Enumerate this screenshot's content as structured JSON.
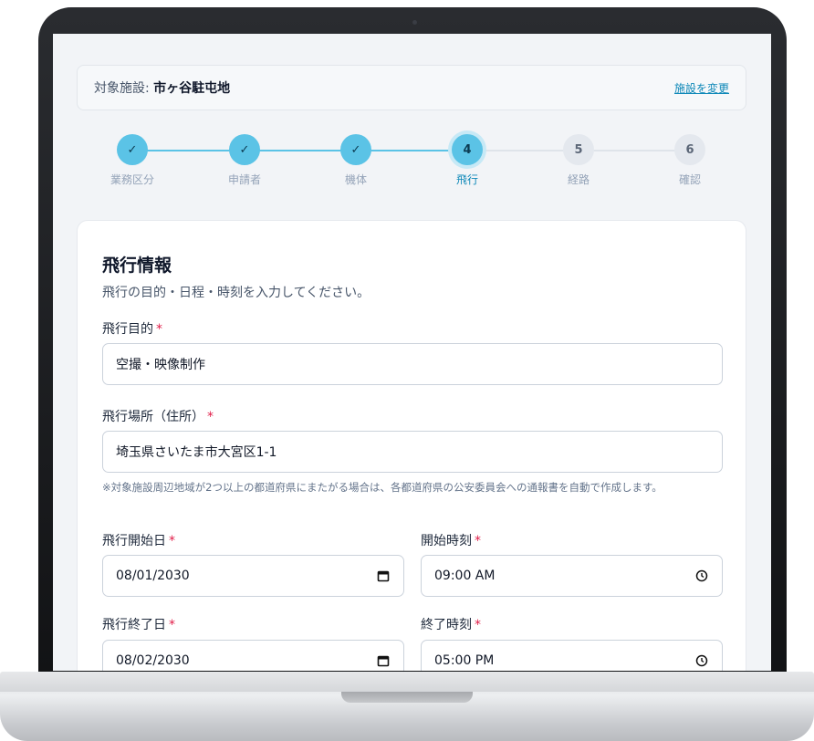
{
  "facility": {
    "label": "対象施設: ",
    "name": "市ヶ谷駐屯地",
    "change_link": "施設を変更"
  },
  "stepper": {
    "steps": [
      {
        "label": "業務区分",
        "mark": "✓",
        "status": "done"
      },
      {
        "label": "申請者",
        "mark": "✓",
        "status": "done"
      },
      {
        "label": "機体",
        "mark": "✓",
        "status": "done"
      },
      {
        "label": "飛行",
        "mark": "4",
        "status": "active"
      },
      {
        "label": "経路",
        "mark": "5",
        "status": "todo"
      },
      {
        "label": "確認",
        "mark": "6",
        "status": "todo"
      }
    ]
  },
  "form": {
    "title": "飛行情報",
    "description": "飛行の目的・日程・時刻を入力してください。",
    "required_mark": "*",
    "purpose": {
      "label": "飛行目的",
      "value": "空撮・映像制作"
    },
    "location": {
      "label": "飛行場所（住所）",
      "value": "埼玉県さいたま市大宮区1-1"
    },
    "note": "※対象施設周辺地域が2つ以上の都道府県にまたがる場合は、各都道府県の公安委員会への通報書を自動で作成します。",
    "start_date": {
      "label": "飛行開始日",
      "value": "08/01/2030"
    },
    "start_time": {
      "label": "開始時刻",
      "value": "09:00 AM"
    },
    "end_date": {
      "label": "飛行終了日",
      "value": "08/02/2030"
    },
    "end_time": {
      "label": "終了時刻",
      "value": "05:00 PM"
    }
  },
  "icons": {
    "date": "calendar-icon",
    "time": "clock-icon"
  },
  "colors": {
    "accent": "#5bc3e6",
    "link": "#0e88b8",
    "required": "#e11d48"
  }
}
